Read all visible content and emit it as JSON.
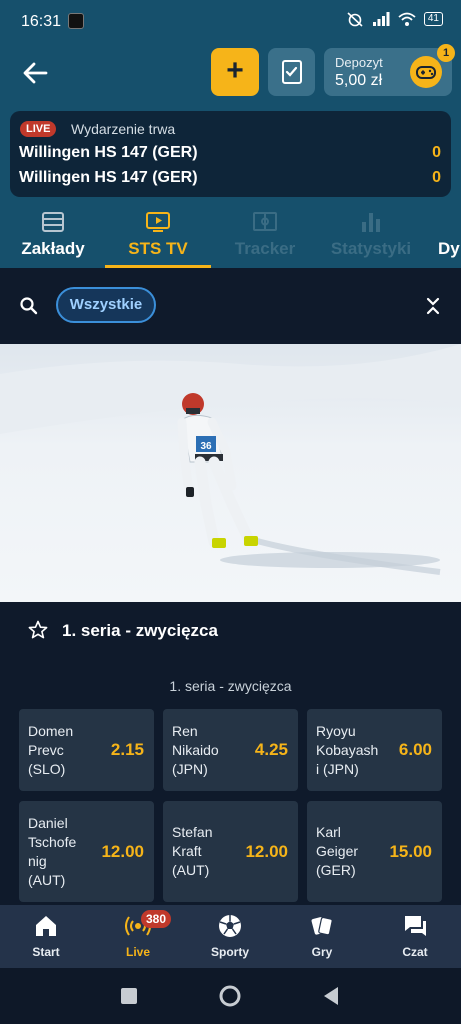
{
  "status_bar": {
    "time": "16:31",
    "battery": "41"
  },
  "header": {
    "plus_label": "+",
    "deposit_label": "Depozyt",
    "deposit_amount": "5,00 zł",
    "game_badge": "1"
  },
  "event": {
    "live_badge": "LIVE",
    "status": "Wydarzenie trwa",
    "team1": "Willingen HS 147 (GER)",
    "score1": "0",
    "team2": "Willingen HS 147 (GER)",
    "score2": "0"
  },
  "tabs": [
    {
      "label": "Zakłady",
      "icon": "list-icon"
    },
    {
      "label": "STS TV",
      "icon": "tv-icon"
    },
    {
      "label": "Tracker",
      "icon": "field-icon"
    },
    {
      "label": "Statystyki",
      "icon": "bar-chart-icon"
    },
    {
      "label": "Dy",
      "icon": ""
    }
  ],
  "filter": {
    "chip": "Wszystkie"
  },
  "market": {
    "title": "1. seria  - zwycięzca",
    "subtitle": "1. seria  - zwycięzca",
    "odds": [
      {
        "name_lines": [
          "Domen",
          "Prevc",
          "(SLO)"
        ],
        "price": "2.15"
      },
      {
        "name_lines": [
          "Ren",
          "Nikaido",
          "(JPN)"
        ],
        "price": "4.25"
      },
      {
        "name_lines": [
          "Ryoyu",
          "Kobayash",
          "i (JPN)"
        ],
        "price": "6.00"
      },
      {
        "name_lines": [
          "Daniel",
          "Tschofe",
          "nig",
          "(AUT)"
        ],
        "price": "12.00"
      },
      {
        "name_lines": [
          "Stefan",
          "Kraft",
          "(AUT)"
        ],
        "price": "12.00"
      },
      {
        "name_lines": [
          "Karl",
          "Geiger",
          "(GER)"
        ],
        "price": "15.00"
      }
    ]
  },
  "video": {
    "bib_number": "36"
  },
  "bottom_nav": [
    {
      "label": "Start",
      "icon": "home-icon"
    },
    {
      "label": "Live",
      "icon": "live-broadcast-icon",
      "badge": "380"
    },
    {
      "label": "Sporty",
      "icon": "soccer-ball-icon"
    },
    {
      "label": "Gry",
      "icon": "cards-icon"
    },
    {
      "label": "Czat",
      "icon": "chat-icon"
    }
  ],
  "colors": {
    "accent": "#f6b419",
    "header_bg": "#16506c",
    "live_red": "#c0392b",
    "chip_border": "#3b8fd9"
  }
}
